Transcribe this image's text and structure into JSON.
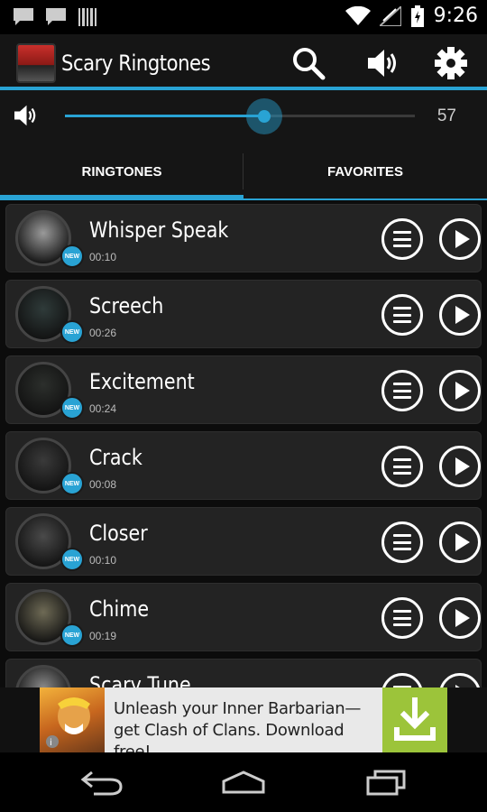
{
  "status_bar": {
    "time": "9:26"
  },
  "app": {
    "title": "Scary Ringtones"
  },
  "volume": {
    "value": "57",
    "level": 0.57
  },
  "tabs": [
    {
      "label": "RINGTONES",
      "active": true
    },
    {
      "label": "FAVORITES",
      "active": false
    }
  ],
  "ringtones": [
    {
      "title": "Whisper Speak",
      "duration": "00:10",
      "badge": "NEW"
    },
    {
      "title": "Screech",
      "duration": "00:26",
      "badge": "NEW"
    },
    {
      "title": "Excitement",
      "duration": "00:24",
      "badge": "NEW"
    },
    {
      "title": "Crack",
      "duration": "00:08",
      "badge": "NEW"
    },
    {
      "title": "Closer",
      "duration": "00:10",
      "badge": "NEW"
    },
    {
      "title": "Chime",
      "duration": "00:19",
      "badge": "NEW"
    },
    {
      "title": "Scary Tune",
      "duration": "",
      "badge": ""
    }
  ],
  "ad": {
    "text": "Unleash your Inner Barbarian—get Clash of Clans. Download free!"
  },
  "colors": {
    "accent": "#29a3d4",
    "ad_button": "#9cc43a"
  },
  "icons": [
    "notification-icon",
    "barcode-icon",
    "wifi-icon",
    "signal-icon",
    "battery-icon",
    "search-icon",
    "speaker-icon",
    "gear-icon",
    "menu-icon",
    "play-icon",
    "download-icon",
    "back-icon",
    "home-icon",
    "recents-icon"
  ]
}
